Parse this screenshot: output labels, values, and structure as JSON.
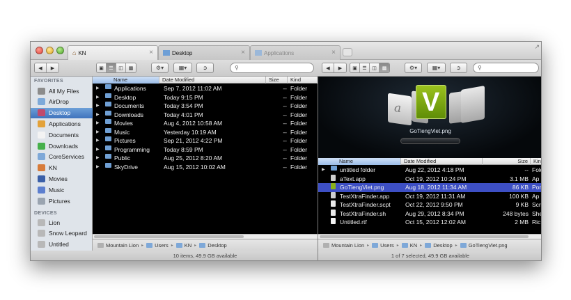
{
  "tabs": [
    {
      "label": "KN",
      "state": "active"
    },
    {
      "label": "Desktop",
      "state": "normal"
    },
    {
      "label": "Applications",
      "state": "inactive"
    }
  ],
  "left_toolbar": {
    "search_placeholder": ""
  },
  "right_toolbar": {
    "search_placeholder": ""
  },
  "sidebar": {
    "favorites_heading": "FAVORITES",
    "favorites": [
      {
        "label": "All My Files",
        "icon": "all-files-icon",
        "selected": false
      },
      {
        "label": "AirDrop",
        "icon": "airdrop-icon",
        "selected": false
      },
      {
        "label": "Desktop",
        "icon": "desktop-icon",
        "selected": true
      },
      {
        "label": "Applications",
        "icon": "applications-icon",
        "selected": false
      },
      {
        "label": "Documents",
        "icon": "documents-icon",
        "selected": false
      },
      {
        "label": "Downloads",
        "icon": "downloads-icon",
        "selected": false
      },
      {
        "label": "CoreServices",
        "icon": "folder-icon",
        "selected": false
      },
      {
        "label": "KN",
        "icon": "home-icon",
        "selected": false
      },
      {
        "label": "Movies",
        "icon": "movies-icon",
        "selected": false
      },
      {
        "label": "Music",
        "icon": "music-icon",
        "selected": false
      },
      {
        "label": "Pictures",
        "icon": "pictures-icon",
        "selected": false
      }
    ],
    "devices_heading": "DEVICES",
    "devices": [
      {
        "label": "Lion",
        "icon": "disk-icon"
      },
      {
        "label": "Snow Leopard",
        "icon": "disk-icon"
      },
      {
        "label": "Untitled",
        "icon": "disk-icon"
      }
    ]
  },
  "left_pane": {
    "columns": [
      "Name",
      "Date Modified",
      "Size",
      "Kind"
    ],
    "rows": [
      {
        "name": "Applications",
        "date": "Sep 7, 2012 11:02 AM",
        "size": "--",
        "kind": "Folder"
      },
      {
        "name": "Desktop",
        "date": "Today 9:15 PM",
        "size": "--",
        "kind": "Folder"
      },
      {
        "name": "Documents",
        "date": "Today 3:54 PM",
        "size": "--",
        "kind": "Folder"
      },
      {
        "name": "Downloads",
        "date": "Today 4:01 PM",
        "size": "--",
        "kind": "Folder"
      },
      {
        "name": "Movies",
        "date": "Aug 4, 2012 10:58 AM",
        "size": "--",
        "kind": "Folder"
      },
      {
        "name": "Music",
        "date": "Yesterday 10:19 AM",
        "size": "--",
        "kind": "Folder"
      },
      {
        "name": "Pictures",
        "date": "Sep 21, 2012 4:22 PM",
        "size": "--",
        "kind": "Folder"
      },
      {
        "name": "Programming",
        "date": "Today 8:59 PM",
        "size": "--",
        "kind": "Folder"
      },
      {
        "name": "Public",
        "date": "Aug 25, 2012 8:20 AM",
        "size": "--",
        "kind": "Folder"
      },
      {
        "name": "SkyDrive",
        "date": "Aug 15, 2012 10:02 AM",
        "size": "--",
        "kind": "Folder"
      }
    ],
    "path": [
      "Mountain Lion",
      "Users",
      "KN",
      "Desktop"
    ],
    "status": "10 items, 49.9 GB available"
  },
  "right_pane": {
    "preview_caption": "GoTiengViet.png",
    "preview_letter": "V",
    "preview_side_letter": "a",
    "columns": [
      "Name",
      "Date Modified",
      "Size",
      "Kind"
    ],
    "rows": [
      {
        "name": "untitled folder",
        "date": "Aug 22, 2012 4:18 PM",
        "size": "--",
        "kind": "Fold",
        "type": "folder",
        "selected": false
      },
      {
        "name": "aText.app",
        "date": "Oct 19, 2012 10:24 PM",
        "size": "3.1 MB",
        "kind": "Ap",
        "type": "app",
        "selected": false
      },
      {
        "name": "GoTiengViet.png",
        "date": "Aug 18, 2012 11:34 AM",
        "size": "86 KB",
        "kind": "Por",
        "type": "image",
        "selected": true
      },
      {
        "name": "TestXtraFinder.app",
        "date": "Oct 19, 2012 11:31 AM",
        "size": "100 KB",
        "kind": "Ap",
        "type": "app",
        "selected": false
      },
      {
        "name": "TestXtraFinder.scpt",
        "date": "Oct 22, 2012 9:50 PM",
        "size": "9 KB",
        "kind": "Scri",
        "type": "script",
        "selected": false
      },
      {
        "name": "TestXtraFinder.sh",
        "date": "Aug 29, 2012 8:34 PM",
        "size": "248 bytes",
        "kind": "She",
        "type": "script",
        "selected": false
      },
      {
        "name": "Untitled.rtf",
        "date": "Oct 15, 2012 12:02 AM",
        "size": "2 MB",
        "kind": "Ric",
        "type": "document",
        "selected": false
      }
    ],
    "path": [
      "Mountain Lion",
      "Users",
      "KN",
      "Desktop",
      "GoTiengViet.png"
    ],
    "status": "1 of 7 selected, 49.9 GB available"
  },
  "colors": {
    "selection": "#3d4fc4",
    "sidebar_selection": "#4a7cc2",
    "preview_green": "#7aa80f"
  }
}
